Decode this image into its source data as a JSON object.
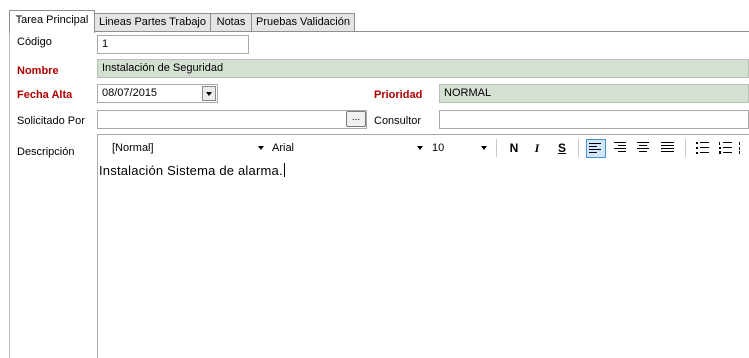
{
  "tabs": [
    {
      "label": "Tarea Principal",
      "active": true
    },
    {
      "label": "Lineas Partes Trabajo",
      "active": false
    },
    {
      "label": "Notas",
      "active": false
    },
    {
      "label": "Pruebas Validación",
      "active": false
    }
  ],
  "form": {
    "codigo_label": "Código",
    "codigo_value": "1",
    "nombre_label": "Nombre",
    "nombre_value": "Instalación de Seguridad",
    "fecha_label": "Fecha Alta",
    "fecha_value": "08/07/2015",
    "prioridad_label": "Prioridad",
    "prioridad_value": "NORMAL",
    "solicitado_label": "Solicitado Por",
    "solicitado_value": "",
    "ellipsis_label": "...",
    "consultor_label": "Consultor",
    "consultor_value": "",
    "descripcion_label": "Descripción"
  },
  "editor": {
    "style_value": "[Normal]",
    "font_value": "Arial",
    "size_value": "10",
    "bold_label": "N",
    "italic_label": "I",
    "strike_label": "S",
    "content": "Instalación Sistema de alarma."
  },
  "colors": {
    "required_label": "#b00000",
    "readonly_field": "#d4e0d2",
    "active_toolbar": "#cfe6fb"
  }
}
